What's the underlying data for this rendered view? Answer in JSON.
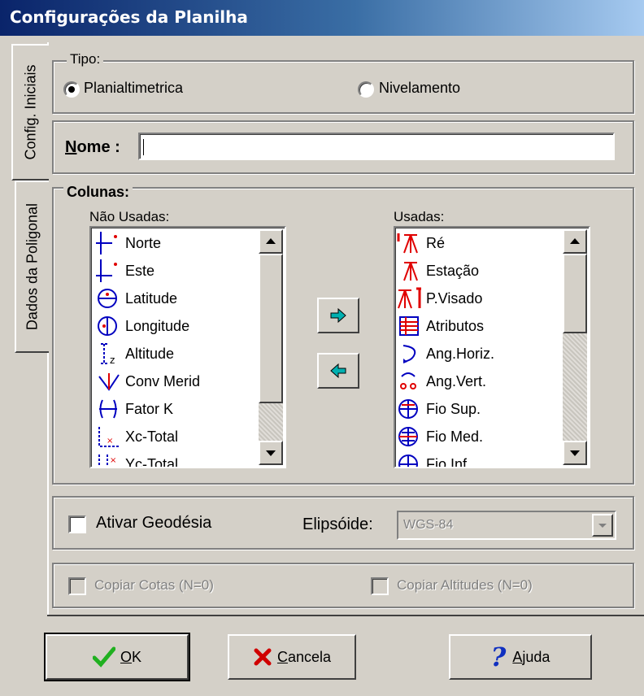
{
  "window": {
    "title": "Configurações da Planilha"
  },
  "tabs": [
    {
      "label": "Config. Iniciais"
    },
    {
      "label": "Dados da Poligonal"
    }
  ],
  "tipo": {
    "legend": "Tipo:",
    "options": [
      {
        "label": "Planialtimetrica",
        "selected": true
      },
      {
        "label": "Nivelamento",
        "selected": false
      }
    ]
  },
  "nome": {
    "label_prefix": "N",
    "label_rest": "ome :",
    "value": ""
  },
  "colunas": {
    "legend": "Colunas:",
    "nao_usadas": {
      "label": "Não Usadas:",
      "items": [
        "Norte",
        "Este",
        "Latitude",
        "Longitude",
        "Altitude",
        "Conv Merid",
        "Fator K",
        "Xc-Total",
        "Yc-Total"
      ]
    },
    "usadas": {
      "label": "Usadas:",
      "items": [
        "Ré",
        "Estação",
        "P.Visado",
        "Atributos",
        "Ang.Horiz.",
        "Ang.Vert.",
        "Fio Sup.",
        "Fio Med.",
        "Fio Inf."
      ]
    }
  },
  "geodesia": {
    "checkbox_label": "Ativar Geodésia",
    "checked": false,
    "elipsoide_label": "Elipsóide:",
    "elipsoide_value": "WGS-84"
  },
  "copiar": {
    "cotas_label": "Copiar Cotas (N=0)",
    "altitudes_label": "Copiar Altitudes (N=0)"
  },
  "buttons": {
    "ok": {
      "mnemonic": "O",
      "rest": "K"
    },
    "cancela": {
      "mnemonic": "C",
      "rest": "ancela"
    },
    "ajuda": {
      "mnemonic": "A",
      "rest": "juda"
    }
  },
  "colors": {
    "title_start": "#0a246a",
    "title_end": "#a6caf0",
    "face": "#d4d0c8",
    "icon_red": "#e00000",
    "icon_blue": "#0000c0",
    "arrow_cyan": "#00b0b0",
    "ok_green": "#20b020",
    "cancel_red": "#d00000",
    "help_blue": "#1030c0"
  }
}
